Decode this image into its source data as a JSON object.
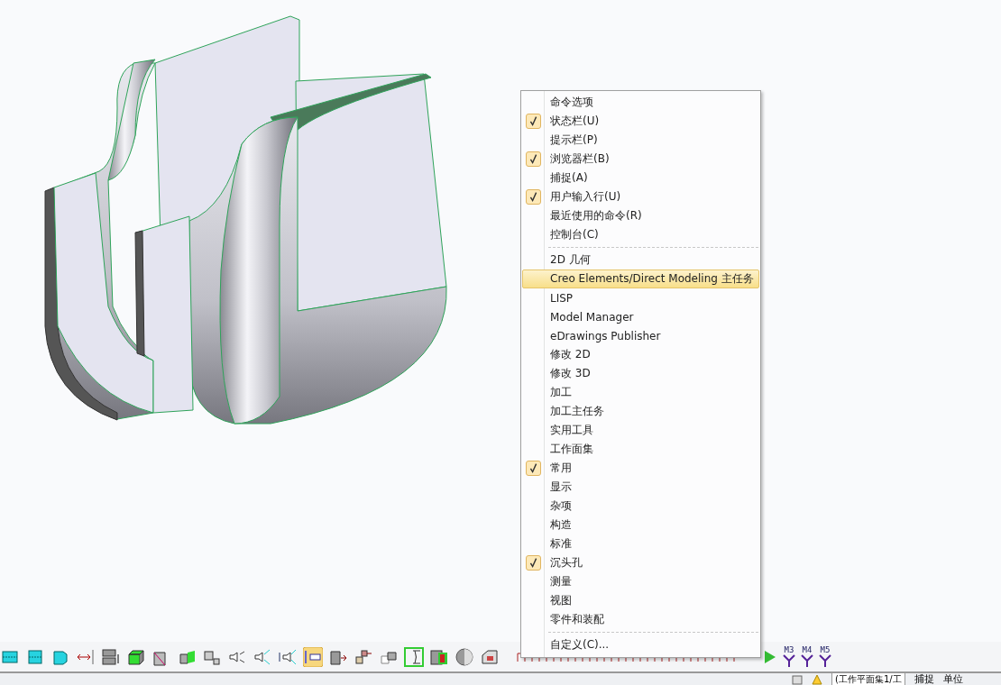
{
  "context_menu": {
    "items": [
      {
        "kind": "item",
        "label": "命令选项",
        "checked": false,
        "selected": false
      },
      {
        "kind": "item",
        "label": "状态栏(U)",
        "checked": true,
        "selected": false
      },
      {
        "kind": "item",
        "label": "提示栏(P)",
        "checked": false,
        "selected": false
      },
      {
        "kind": "item",
        "label": "浏览器栏(B)",
        "checked": true,
        "selected": false
      },
      {
        "kind": "item",
        "label": "捕捉(A)",
        "checked": false,
        "selected": false
      },
      {
        "kind": "item",
        "label": "用户输入行(U)",
        "checked": true,
        "selected": false
      },
      {
        "kind": "item",
        "label": "最近使用的命令(R)",
        "checked": false,
        "selected": false
      },
      {
        "kind": "item",
        "label": "控制台(C)",
        "checked": false,
        "selected": false
      },
      {
        "kind": "separator"
      },
      {
        "kind": "item",
        "label": "2D 几何",
        "checked": false,
        "selected": false
      },
      {
        "kind": "item",
        "label": "Creo Elements/Direct Modeling 主任务",
        "checked": false,
        "selected": true
      },
      {
        "kind": "item",
        "label": "LISP",
        "checked": false,
        "selected": false
      },
      {
        "kind": "item",
        "label": "Model Manager",
        "checked": false,
        "selected": false
      },
      {
        "kind": "item",
        "label": "eDrawings Publisher",
        "checked": false,
        "selected": false
      },
      {
        "kind": "item",
        "label": "修改 2D",
        "checked": false,
        "selected": false
      },
      {
        "kind": "item",
        "label": "修改 3D",
        "checked": false,
        "selected": false
      },
      {
        "kind": "item",
        "label": "加工",
        "checked": false,
        "selected": false
      },
      {
        "kind": "item",
        "label": "加工主任务",
        "checked": false,
        "selected": false
      },
      {
        "kind": "item",
        "label": "实用工具",
        "checked": false,
        "selected": false
      },
      {
        "kind": "item",
        "label": "工作面集",
        "checked": false,
        "selected": false
      },
      {
        "kind": "item",
        "label": "常用",
        "checked": true,
        "selected": false
      },
      {
        "kind": "item",
        "label": "显示",
        "checked": false,
        "selected": false
      },
      {
        "kind": "item",
        "label": "杂项",
        "checked": false,
        "selected": false
      },
      {
        "kind": "item",
        "label": "构造",
        "checked": false,
        "selected": false
      },
      {
        "kind": "item",
        "label": "标准",
        "checked": false,
        "selected": false
      },
      {
        "kind": "item",
        "label": "沉头孔",
        "checked": true,
        "selected": false
      },
      {
        "kind": "item",
        "label": "测量",
        "checked": false,
        "selected": false
      },
      {
        "kind": "item",
        "label": "视图",
        "checked": false,
        "selected": false
      },
      {
        "kind": "item",
        "label": "零件和装配",
        "checked": false,
        "selected": false
      },
      {
        "kind": "separator"
      },
      {
        "kind": "item",
        "label": "自定义(C)...",
        "checked": false,
        "selected": false
      }
    ]
  },
  "toolbar": {
    "macro_labels": [
      "M3",
      "M4",
      "M5"
    ]
  },
  "status_bar": {
    "workplane_field": "(工作平面集1/工",
    "snap": "捕捉",
    "units": "单位"
  }
}
